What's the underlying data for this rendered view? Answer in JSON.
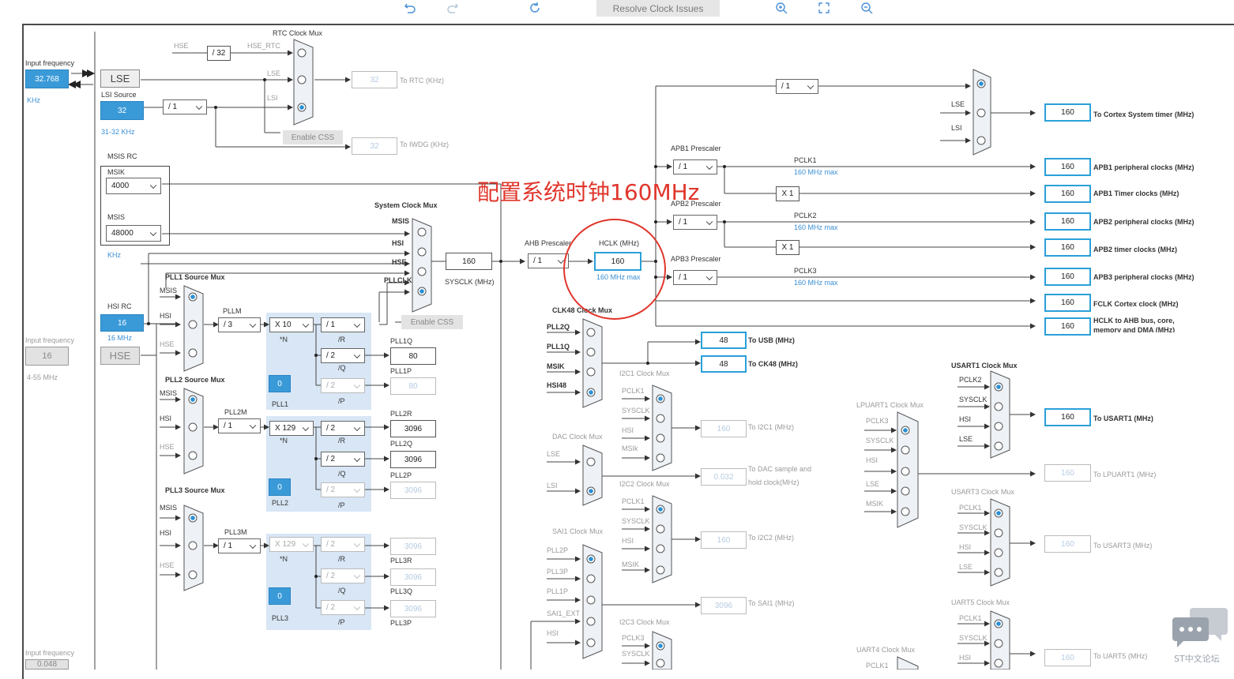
{
  "toolbar": {
    "undo_icon": "undo-icon",
    "redo_icon": "redo-icon",
    "refresh_icon": "refresh-icon",
    "resolve_label": "Resolve Clock Issues",
    "zoom_in_icon": "zoom-in-icon",
    "fit_icon": "fit-screen-icon",
    "zoom_out_icon": "zoom-out-icon"
  },
  "annotation": {
    "text": "配置系统时钟160MHz",
    "color": "#e0352b"
  },
  "inputs": {
    "lse_freq_label": "Input frequency",
    "lse_freq": "32.768",
    "lse_unit": "KHz",
    "lse_label": "LSE",
    "lsi_source_label": "LSI Source",
    "lsi_value": "32",
    "lsi_range": "31-32 KHz",
    "msis_rc_label": "MSIS RC",
    "msik_label": "MSIK",
    "msik_value": "4000",
    "msis_label": "MSIS",
    "msis_value": "48000",
    "msis_unit": "KHz",
    "hsi_rc_label": "HSI RC",
    "hsi_value": "16",
    "hsi_unit": "16 MHz",
    "hse_freq_label": "Input frequency",
    "hse_freq": "16",
    "hse_label": "HSE",
    "hse_range": "4-55 MHz",
    "bottom_freq_label": "Input frequency",
    "bottom_freq": "0.048"
  },
  "rtc": {
    "mux_label": "RTC Clock Mux",
    "hse": "HSE",
    "div": "/ 32",
    "hse_rtc": "HSE_RTC",
    "lse": "LSE",
    "lsi": "LSI",
    "lsi_div": "/ 1",
    "rtc_value": "32",
    "rtc_label": "To RTC (KHz)",
    "enable_css": "Enable CSS",
    "iwdg_value": "32",
    "iwdg_label": "To IWDG (KHz)"
  },
  "sysclk": {
    "mux_label": "System Clock Mux",
    "in_msis": "MSIS",
    "in_hsi": "HSI",
    "in_hse": "HSE",
    "in_pllclk": "PLLCLK",
    "value": "160",
    "label": "SYSCLK (MHz)",
    "enable_css": "Enable CSS"
  },
  "ahb": {
    "label": "AHB Prescaler",
    "value": "/ 1",
    "hclk_label": "HCLK (MHz)",
    "hclk_value": "160",
    "hclk_max": "160 MHz max"
  },
  "cortex": {
    "div": "/ 1",
    "lse": "LSE",
    "lsi": "LSI",
    "value": "160",
    "label": "To Cortex System timer (MHz)"
  },
  "apb": {
    "apb1_label": "APB1 Prescaler",
    "apb1_value": "/ 1",
    "pclk1": "PCLK1",
    "pclk1_max": "160 MHz max",
    "apb1_periph_value": "160",
    "apb1_periph_label": "APB1 peripheral clocks (MHz)",
    "x1a": "X 1",
    "apb1_timer_value": "160",
    "apb1_timer_label": "APB1 Timer clocks (MHz)",
    "apb2_label": "APB2 Prescaler",
    "apb2_value": "/ 1",
    "pclk2": "PCLK2",
    "pclk2_max": "160 MHz max",
    "apb2_periph_value": "160",
    "apb2_periph_label": "APB2 peripheral clocks (MHz)",
    "x1b": "X 1",
    "apb2_timer_value": "160",
    "apb2_timer_label": "APB2 timer clocks (MHz)",
    "apb3_label": "APB3 Prescaler",
    "apb3_value": "/ 1",
    "pclk3": "PCLK3",
    "pclk3_max": "160 MHz max",
    "apb3_periph_value": "160",
    "apb3_periph_label": "APB3 peripheral clocks (MHz)",
    "fclk_value": "160",
    "fclk_label": "FCLK Cortex clock (MHz)",
    "hclk_bus_value": "160",
    "hclk_bus_label1": "HCLK to AHB bus, core,",
    "hclk_bus_label2": "memory and DMA (MHz)"
  },
  "pll1": {
    "mux_label": "PLL1 Source Mux",
    "msis": "MSIS",
    "hsi": "HSI",
    "hse": "HSE",
    "m_label": "PLLM",
    "m_value": "/ 3",
    "n_value": "X 10",
    "n_label": "*N",
    "r_value": "/ 1",
    "r_label": "/R",
    "q_value": "/ 2",
    "q_label": "/Q",
    "p_value": "/ 2",
    "p_label": "/P",
    "frac": "0",
    "name": "PLL1",
    "out_q_label": "PLL1Q",
    "out_q": "80",
    "out_p_label": "PLL1P",
    "out_p": "80"
  },
  "pll2": {
    "mux_label": "PLL2 Source Mux",
    "msis": "MSIS",
    "hsi": "HSI",
    "hse": "HSE",
    "m_label": "PLL2M",
    "m_value": "/ 1",
    "n_value": "X 129",
    "n_label": "*N",
    "r_value": "/ 2",
    "r_label": "/R",
    "q_value": "/ 2",
    "q_label": "/Q",
    "p_value": "/ 2",
    "p_label": "/P",
    "frac": "0",
    "name": "PLL2",
    "out_r_label": "PLL2R",
    "out_r": "3096",
    "out_q_label": "PLL2Q",
    "out_q": "3096",
    "out_p_label": "PLL2P",
    "out_p": "3096"
  },
  "pll3": {
    "mux_label": "PLL3 Source Mux",
    "msis": "MSIS",
    "hsi": "HSI",
    "hse": "HSE",
    "m_label": "PLL3M",
    "m_value": "/ 1",
    "n_value": "X 129",
    "n_label": "*N",
    "r_value": "/ 2",
    "r_label": "/R",
    "q_value": "/ 2",
    "q_label": "/Q",
    "p_value": "/ 2",
    "p_label": "/P",
    "frac": "0",
    "name": "PLL3",
    "out_r_label": "PLL3R",
    "out_r": "3096",
    "out_q_label": "PLL3Q",
    "out_q": "3096",
    "out_p_label": "PLL3P",
    "out_p": "3096"
  },
  "clk48": {
    "mux_label": "CLK48 Clock Mux",
    "in1": "PLL2Q",
    "in2": "PLL1Q",
    "in3": "MSIK",
    "in4": "HSI48",
    "usb_value": "48",
    "usb_label": "To USB (MHz)",
    "ck48_value": "48",
    "ck48_label": "To CK48 (MHz)"
  },
  "i2c1": {
    "mux_label": "I2C1 Clock Mux",
    "in1": "PCLK1",
    "in2": "SYSCLK",
    "in3": "HSI",
    "in4": "MSIk",
    "value": "160",
    "label": "To I2C1 (MHz)"
  },
  "dac": {
    "mux_label": "DAC Clock Mux",
    "in1": "LSE",
    "in2": "LSI",
    "value": "0.032",
    "label1": "To DAC sample and",
    "label2": "hold clock(MHz)"
  },
  "i2c2": {
    "mux_label": "I2C2 Clock Mux",
    "in1": "PCLK1",
    "in2": "SYSCLK",
    "in3": "HSI",
    "in4": "MSIK",
    "value": "160",
    "label": "To I2C2 (MHz)"
  },
  "sai1": {
    "mux_label": "SAI1 Clock Mux",
    "in1": "PLL2P",
    "in2": "PLL3P",
    "in3": "PLL1P",
    "in4": "SAI1_EXT",
    "in5": "HSI",
    "value": "3096",
    "label": "To SAI1 (MHz)"
  },
  "i2c3": {
    "mux_label": "I2C3 Clock Mux",
    "in1": "PCLK3",
    "in2": "SYSCLK"
  },
  "usart1": {
    "mux_label": "USART1 Clock Mux",
    "in1": "PCLK2",
    "in2": "SYSCLK",
    "in3": "HSI",
    "in4": "LSE",
    "value": "160",
    "label": "To USART1 (MHz)"
  },
  "lpuart1": {
    "mux_label": "LPUART1 Clock Mux",
    "in1": "PCLK3",
    "in2": "SYSCLK",
    "in3": "HSI",
    "in4": "LSE",
    "in5": "MSIK",
    "value": "160",
    "label": "To LPUART1 (MHz)"
  },
  "usart3": {
    "mux_label": "USART3 Clock Mux",
    "in1": "PCLK1",
    "in2": "SYSCLK",
    "in3": "HSI",
    "in4": "LSE",
    "value": "160",
    "label": "To USART3 (MHz)"
  },
  "uart5": {
    "mux_label": "UART5 Clock Mux",
    "in1": "PCLK1",
    "in2": "SYSCLK",
    "in3": "HSI",
    "value": "160",
    "label": "To UART5 (MHz)"
  },
  "uart4": {
    "mux_label": "UART4 Clock Mux",
    "in1": "PCLK1"
  },
  "watermark": {
    "text": "ST中文论坛",
    "icon": "chat-bubble-icon"
  }
}
